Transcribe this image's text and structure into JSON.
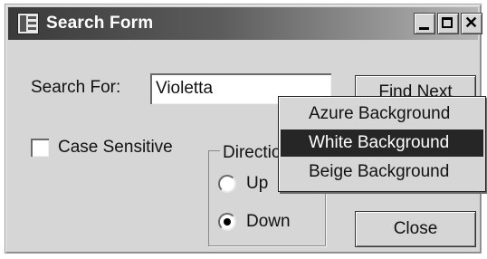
{
  "window": {
    "title": "Search Form",
    "controls": {
      "minimize": "minimize",
      "maximize": "maximize",
      "close": "close"
    }
  },
  "form": {
    "search_label": "Search For:",
    "search_value": "Violetta",
    "find_button": "Find Next",
    "case_sensitive_label": "Case Sensitive",
    "case_sensitive_checked": false,
    "direction_group_label": "Direction",
    "direction_options": [
      {
        "label": "Up",
        "checked": false
      },
      {
        "label": "Down",
        "checked": true
      }
    ],
    "close_button": "Close"
  },
  "context_menu": {
    "items": [
      {
        "label": "Azure Background",
        "highlighted": false
      },
      {
        "label": "White Background",
        "highlighted": true
      },
      {
        "label": "Beige Background",
        "highlighted": false
      }
    ]
  },
  "colors": {
    "window_bg": "#d6d6d6",
    "titlebar_start": "#3a3a3a",
    "titlebar_end": "#b5b5b5",
    "menu_highlight": "#262626"
  }
}
